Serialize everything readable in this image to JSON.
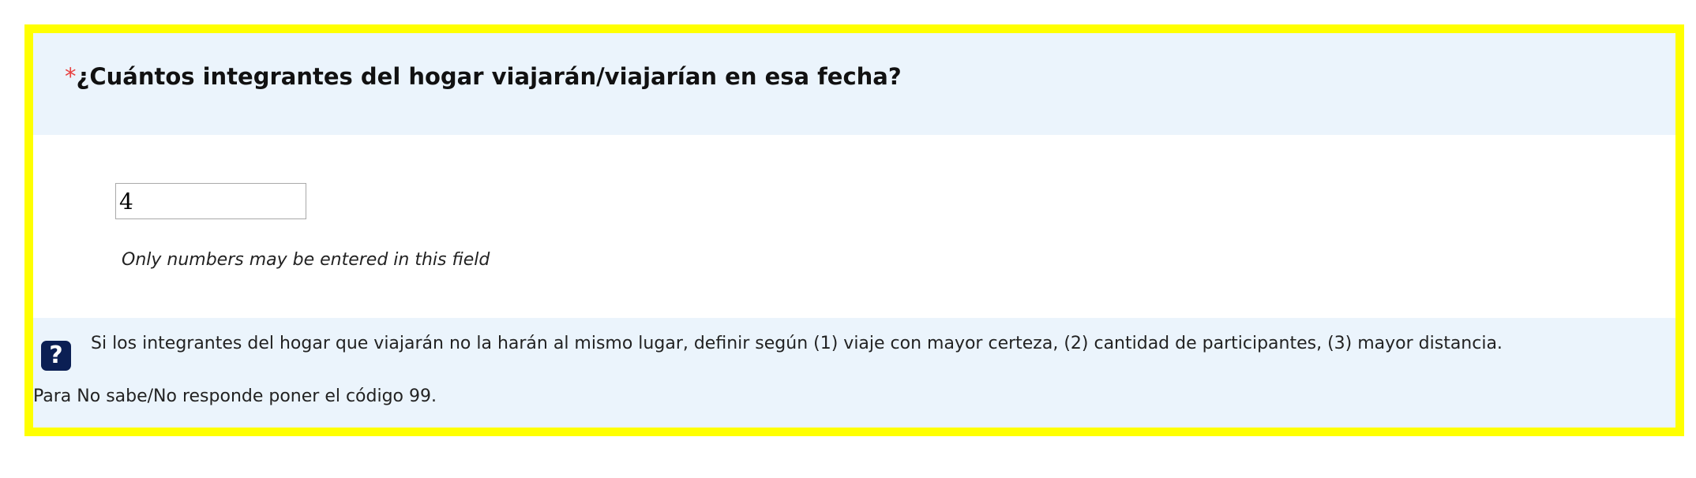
{
  "question": {
    "required_marker": "*",
    "text": "¿Cuántos integrantes del hogar viajarán/viajarían en esa fecha?"
  },
  "answer": {
    "value": "4"
  },
  "validation": {
    "tip": "Only numbers may be entered in this field"
  },
  "help": {
    "icon": "question-mark-icon",
    "icon_glyph": "?",
    "text": "Si los integrantes del hogar que viajarán no la harán al mismo lugar, definir según (1) viaje con mayor certeza, (2) cantidad de participantes, (3) mayor distancia.",
    "note": "Para No sabe/No responde poner el código 99."
  },
  "colors": {
    "frame_border": "#ffff00",
    "header_background": "#ebf4fc",
    "required_marker": "#e84040",
    "help_icon_background": "#0b1f54"
  }
}
